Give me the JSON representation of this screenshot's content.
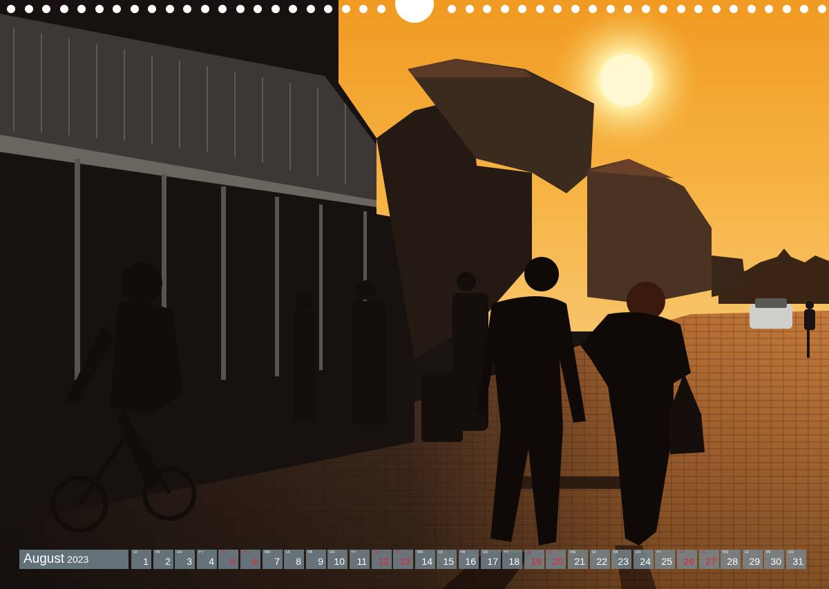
{
  "calendar": {
    "month": "August",
    "year": "2023",
    "days": [
      {
        "wd": "Di",
        "n": "1",
        "red": false
      },
      {
        "wd": "Mi",
        "n": "2",
        "red": false
      },
      {
        "wd": "Do",
        "n": "3",
        "red": false
      },
      {
        "wd": "Fr",
        "n": "4",
        "red": false
      },
      {
        "wd": "Sa",
        "n": "5",
        "red": true
      },
      {
        "wd": "So",
        "n": "6",
        "red": true
      },
      {
        "wd": "Mo",
        "n": "7",
        "red": false
      },
      {
        "wd": "Di",
        "n": "8",
        "red": false
      },
      {
        "wd": "Mi",
        "n": "9",
        "red": false
      },
      {
        "wd": "Do",
        "n": "10",
        "red": false
      },
      {
        "wd": "Fr",
        "n": "11",
        "red": false
      },
      {
        "wd": "Sa",
        "n": "12",
        "red": true
      },
      {
        "wd": "So",
        "n": "13",
        "red": true
      },
      {
        "wd": "Mo",
        "n": "14",
        "red": false
      },
      {
        "wd": "Di",
        "n": "15",
        "red": false
      },
      {
        "wd": "Mi",
        "n": "16",
        "red": false
      },
      {
        "wd": "Do",
        "n": "17",
        "red": false
      },
      {
        "wd": "Fr",
        "n": "18",
        "red": false
      },
      {
        "wd": "Sa",
        "n": "19",
        "red": true
      },
      {
        "wd": "So",
        "n": "20",
        "red": true
      },
      {
        "wd": "Mo",
        "n": "21",
        "red": false
      },
      {
        "wd": "Di",
        "n": "22",
        "red": false
      },
      {
        "wd": "Mi",
        "n": "23",
        "red": false
      },
      {
        "wd": "Do",
        "n": "24",
        "red": false
      },
      {
        "wd": "Fr",
        "n": "25",
        "red": false
      },
      {
        "wd": "Sa",
        "n": "26",
        "red": true
      },
      {
        "wd": "So",
        "n": "27",
        "red": true
      },
      {
        "wd": "Mo",
        "n": "28",
        "red": false
      },
      {
        "wd": "Di",
        "n": "29",
        "red": false
      },
      {
        "wd": "Mi",
        "n": "30",
        "red": false
      },
      {
        "wd": "Do",
        "n": "31",
        "red": false
      }
    ]
  },
  "colors": {
    "sky_top": "#f3a02a",
    "sky_horizon": "#f8c766",
    "sun": "#fff6c8",
    "street_glow": "#e08a3a",
    "silhouette": "#120d0a",
    "weekend": "#e2233a",
    "bar": "#788c96"
  }
}
